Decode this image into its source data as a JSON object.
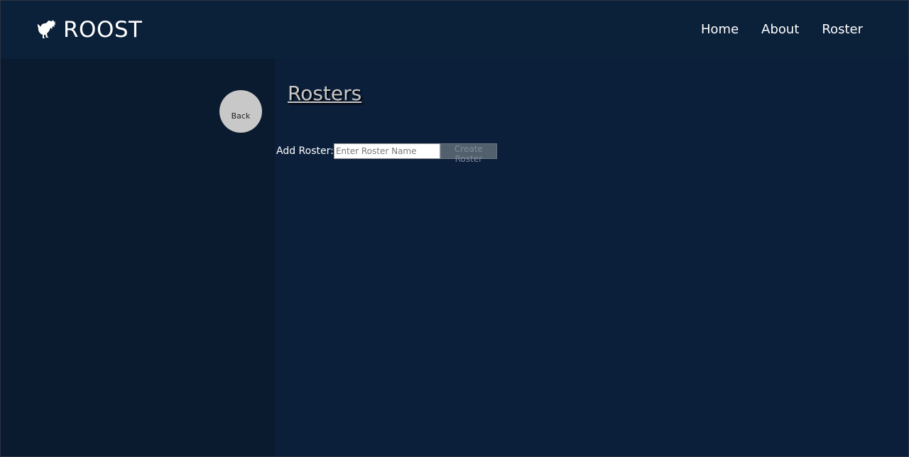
{
  "brand": {
    "name": "ROOST",
    "logo_icon": "rooster-icon"
  },
  "nav": {
    "items": [
      {
        "label": "Home"
      },
      {
        "label": "About"
      },
      {
        "label": "Roster"
      }
    ]
  },
  "back_button": {
    "label": "Back"
  },
  "page": {
    "title": "Rosters"
  },
  "add_roster": {
    "label": "Add Roster:",
    "input_value": "",
    "input_placeholder": "Enter Roster Name",
    "submit_label": "Create Roster"
  },
  "colors": {
    "background": "#0b1f3a",
    "sidebar": "#0a1a2f",
    "text": "#ffffff",
    "title": "#c7c7c7"
  }
}
